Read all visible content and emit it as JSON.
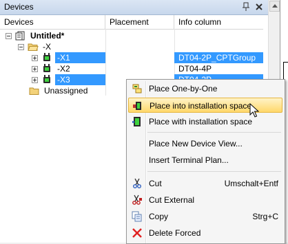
{
  "panel": {
    "title": "Devices",
    "pin_glyph": "⌂",
    "close_glyph": "×"
  },
  "columns": [
    "Devices",
    "Placement",
    "Info column"
  ],
  "tree": {
    "root_label": "Untitled*",
    "folder_label": "-X",
    "devices": [
      {
        "label": "-X1",
        "placement": "",
        "info": "DT04-2P_CPTGroup",
        "selected": true
      },
      {
        "label": "-X2",
        "placement": "",
        "info": "DT04-4P",
        "selected": false
      },
      {
        "label": "-X3",
        "placement": "",
        "info": "DT04-2P",
        "selected": true
      }
    ],
    "unassigned_label": "Unassigned"
  },
  "context_menu": {
    "items": [
      {
        "label": "Place One-by-One",
        "shortcut": "",
        "icon": "place-one-by-one-icon"
      },
      {
        "label": "Place into installation space",
        "shortcut": "",
        "icon": "place-into-space-icon",
        "highlighted": true
      },
      {
        "label": "Place with installation space",
        "shortcut": "",
        "icon": "place-with-space-icon"
      },
      {
        "label": "Place New Device View...",
        "shortcut": "",
        "icon": ""
      },
      {
        "label": "Insert Terminal Plan...",
        "shortcut": "",
        "icon": ""
      },
      {
        "label": "Cut",
        "shortcut": "Umschalt+Entf",
        "icon": "scissors-icon"
      },
      {
        "label": "Cut External",
        "shortcut": "",
        "icon": "cut-external-icon"
      },
      {
        "label": "Copy",
        "shortcut": "Strg+C",
        "icon": "copy-icon"
      },
      {
        "label": "Delete Forced",
        "shortcut": "",
        "icon": "delete-x-icon"
      }
    ]
  },
  "colors": {
    "selection": "#3399ff",
    "menu_highlight": "#ffd86b",
    "delete_red": "#e02020"
  }
}
